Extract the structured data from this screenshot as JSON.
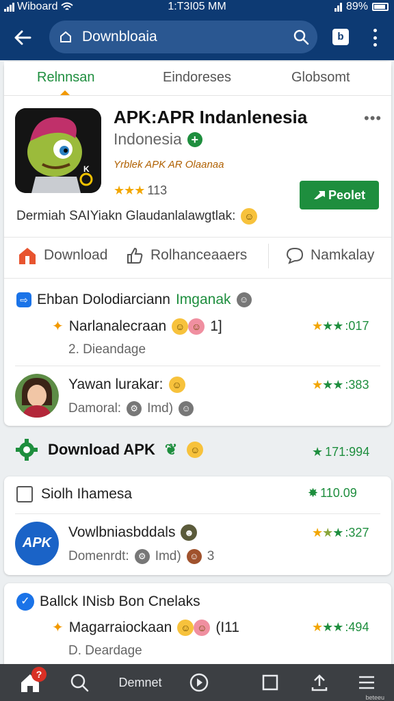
{
  "status_bar": {
    "carrier": "Wiboard",
    "time": "1:T3I05 MM",
    "battery": "89%"
  },
  "app_bar": {
    "search_text": "Downbloaia"
  },
  "tabs": [
    {
      "label": "Relnnsan",
      "active": true
    },
    {
      "label": "Eindoreses",
      "active": false
    },
    {
      "label": "Globsomt",
      "active": false
    }
  ],
  "app": {
    "title": "APK:APR Indanlenesia",
    "subtitle": "Indonesia",
    "developer": "Yrblek APK AR Olaanaa",
    "rating_value": "113",
    "install_label": "Peolet",
    "description": "Dermiah SAIYiakn Glaudanlalawgtlak:",
    "icon_text": "K"
  },
  "actions": [
    {
      "label": "Download"
    },
    {
      "label": "Rolhanceaaers"
    },
    {
      "label": "Namkalay"
    }
  ],
  "list1": {
    "header_title": "Ehban Dolodiarciann",
    "header_highlight": "Imganak",
    "items": [
      {
        "title": "Narlanalecraan",
        "title_suffix": "1]",
        "sub": "2. Dieandage",
        "rating": ":017"
      },
      {
        "title": "Yawan lurakar:",
        "sub": "Damoral:",
        "sub_suffix": "Imd)",
        "rating": ":383"
      }
    ]
  },
  "section": {
    "title": "Download APK",
    "rating": "171:994"
  },
  "list2": {
    "items": [
      {
        "title": "Siolh Ihamesa",
        "rating": "110.09"
      },
      {
        "title": "Vowlbniasbddals",
        "sub": "Domenrdt:",
        "sub_suffix": "Imd)",
        "sub_count": "3",
        "rating": ":327",
        "avatar_text": "APK"
      }
    ]
  },
  "list3": {
    "header_title": "Ballck INisb Bon Cnelaks",
    "items": [
      {
        "title": "Magarraiockaan",
        "title_suffix": "(I11",
        "sub": "D. Deardage",
        "rating": ":494"
      }
    ]
  },
  "bottom_nav": {
    "badge": "?",
    "center_label": "Demnet",
    "corner_text": "beteeu"
  },
  "colors": {
    "primary": "#0d3a73",
    "accent_green": "#1e8e3e",
    "star": "#f2a600",
    "nav_bg": "#3c3f43"
  }
}
